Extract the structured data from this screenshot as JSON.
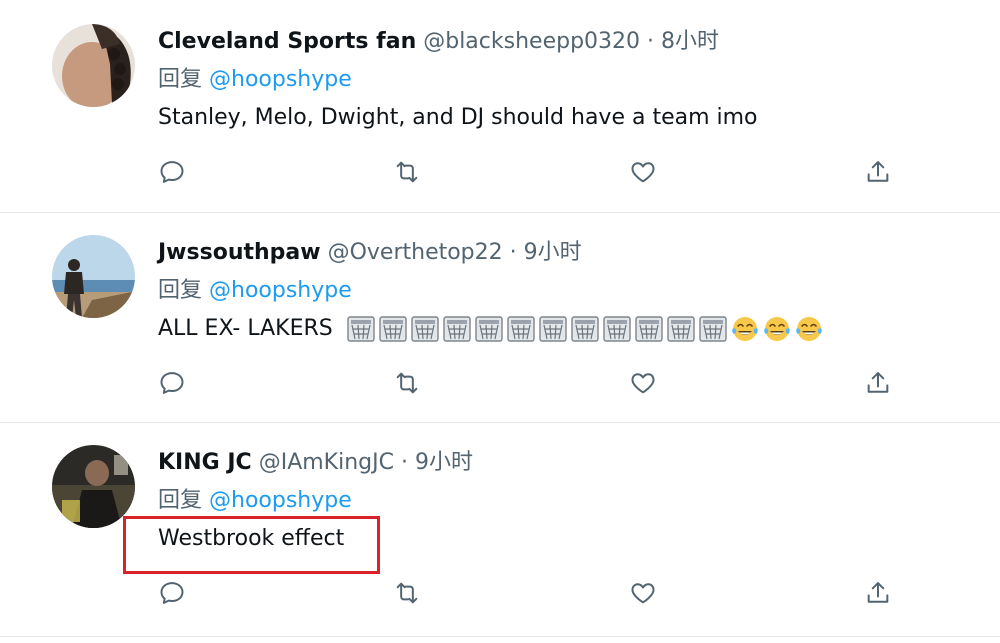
{
  "colors": {
    "mention": "#1d9bf0",
    "secondary_text": "#536471",
    "primary_text": "#0f1419",
    "highlight_box": "#d8232a"
  },
  "tweets": [
    {
      "name": "Cleveland Sports fan",
      "handle": "@blacksheepp0320",
      "separator": "·",
      "time": "8小时",
      "reply_prefix": "回复",
      "reply_to": "@hoopshype",
      "text": "Stanley, Melo, Dwight, and DJ should have a team imo",
      "avatar_icon": "avatar-curly-hair",
      "actions": [
        "reply-icon",
        "retweet-icon",
        "like-icon",
        "share-icon"
      ]
    },
    {
      "name": "Jwssouthpaw",
      "handle": "@Overthetop22",
      "separator": "·",
      "time": "9小时",
      "reply_prefix": "回复",
      "reply_to": "@hoopshype",
      "text": "ALL EX- LAKERS",
      "emojis": [
        "basket",
        "basket",
        "basket",
        "basket",
        "basket",
        "basket",
        "basket",
        "basket",
        "basket",
        "basket",
        "basket",
        "basket",
        "tears-of-joy",
        "tears-of-joy",
        "tears-of-joy"
      ],
      "avatar_icon": "avatar-beach-person",
      "actions": [
        "reply-icon",
        "retweet-icon",
        "like-icon",
        "share-icon"
      ]
    },
    {
      "name": "KING JC",
      "handle": "@IAmKingJC",
      "separator": "·",
      "time": "9小时",
      "reply_prefix": "回复",
      "reply_to": "@hoopshype",
      "text": "Westbrook effect",
      "avatar_icon": "avatar-dark-photo",
      "actions": [
        "reply-icon",
        "retweet-icon",
        "like-icon",
        "share-icon"
      ],
      "highlighted": true
    }
  ]
}
